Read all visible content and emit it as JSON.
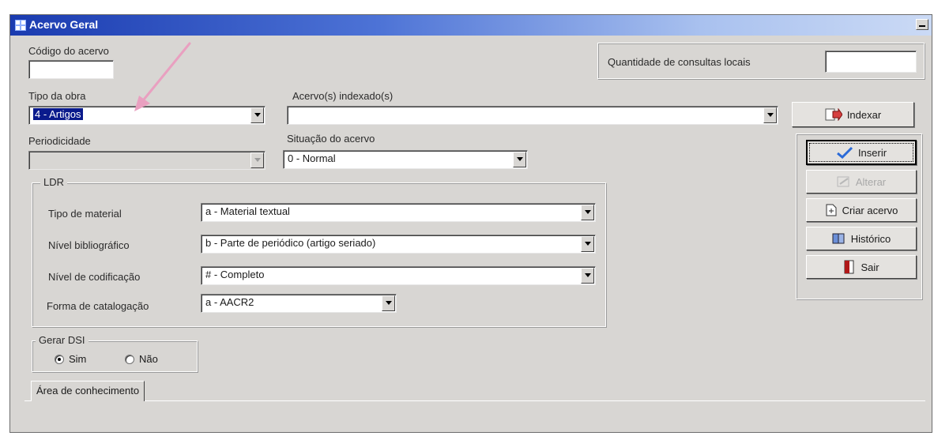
{
  "window": {
    "title": "Acervo Geral"
  },
  "codigo": {
    "label": "Código do acervo",
    "value": ""
  },
  "consultas": {
    "label": "Quantidade de consultas locais",
    "value": ""
  },
  "tipo_obra": {
    "label": "Tipo da obra",
    "value": "4 - Artigos"
  },
  "indexados": {
    "label": "Acervo(s) indexado(s)",
    "value": ""
  },
  "periodicidade": {
    "label": "Periodicidade",
    "value": ""
  },
  "situacao": {
    "label": "Situação do acervo",
    "value": "0 - Normal"
  },
  "ldr": {
    "title": "LDR",
    "tipo_material": {
      "label": "Tipo de material",
      "value": "a - Material textual"
    },
    "nivel_bib": {
      "label": "Nível bibliográfico",
      "value": "b - Parte de periódico (artigo seriado)"
    },
    "nivel_cod": {
      "label": "Nível de codificação",
      "value": "# - Completo"
    },
    "forma_cat": {
      "label": "Forma de catalogação",
      "value": "a - AACR2"
    }
  },
  "dsi": {
    "title": "Gerar DSI",
    "sim": "Sim",
    "nao": "Não",
    "selected": "Sim"
  },
  "tab": {
    "label": "Área de conhecimento"
  },
  "buttons": {
    "indexar": "Indexar",
    "inserir": "Inserir",
    "alterar": "Alterar",
    "criar": "Criar acervo",
    "historico": "Histórico",
    "sair": "Sair"
  },
  "colors": {
    "title_start": "#1a3bb0",
    "title_end": "#cbdaf5",
    "selection": "#0a1a8c",
    "annotation_arrow": "#e9a0c0"
  }
}
